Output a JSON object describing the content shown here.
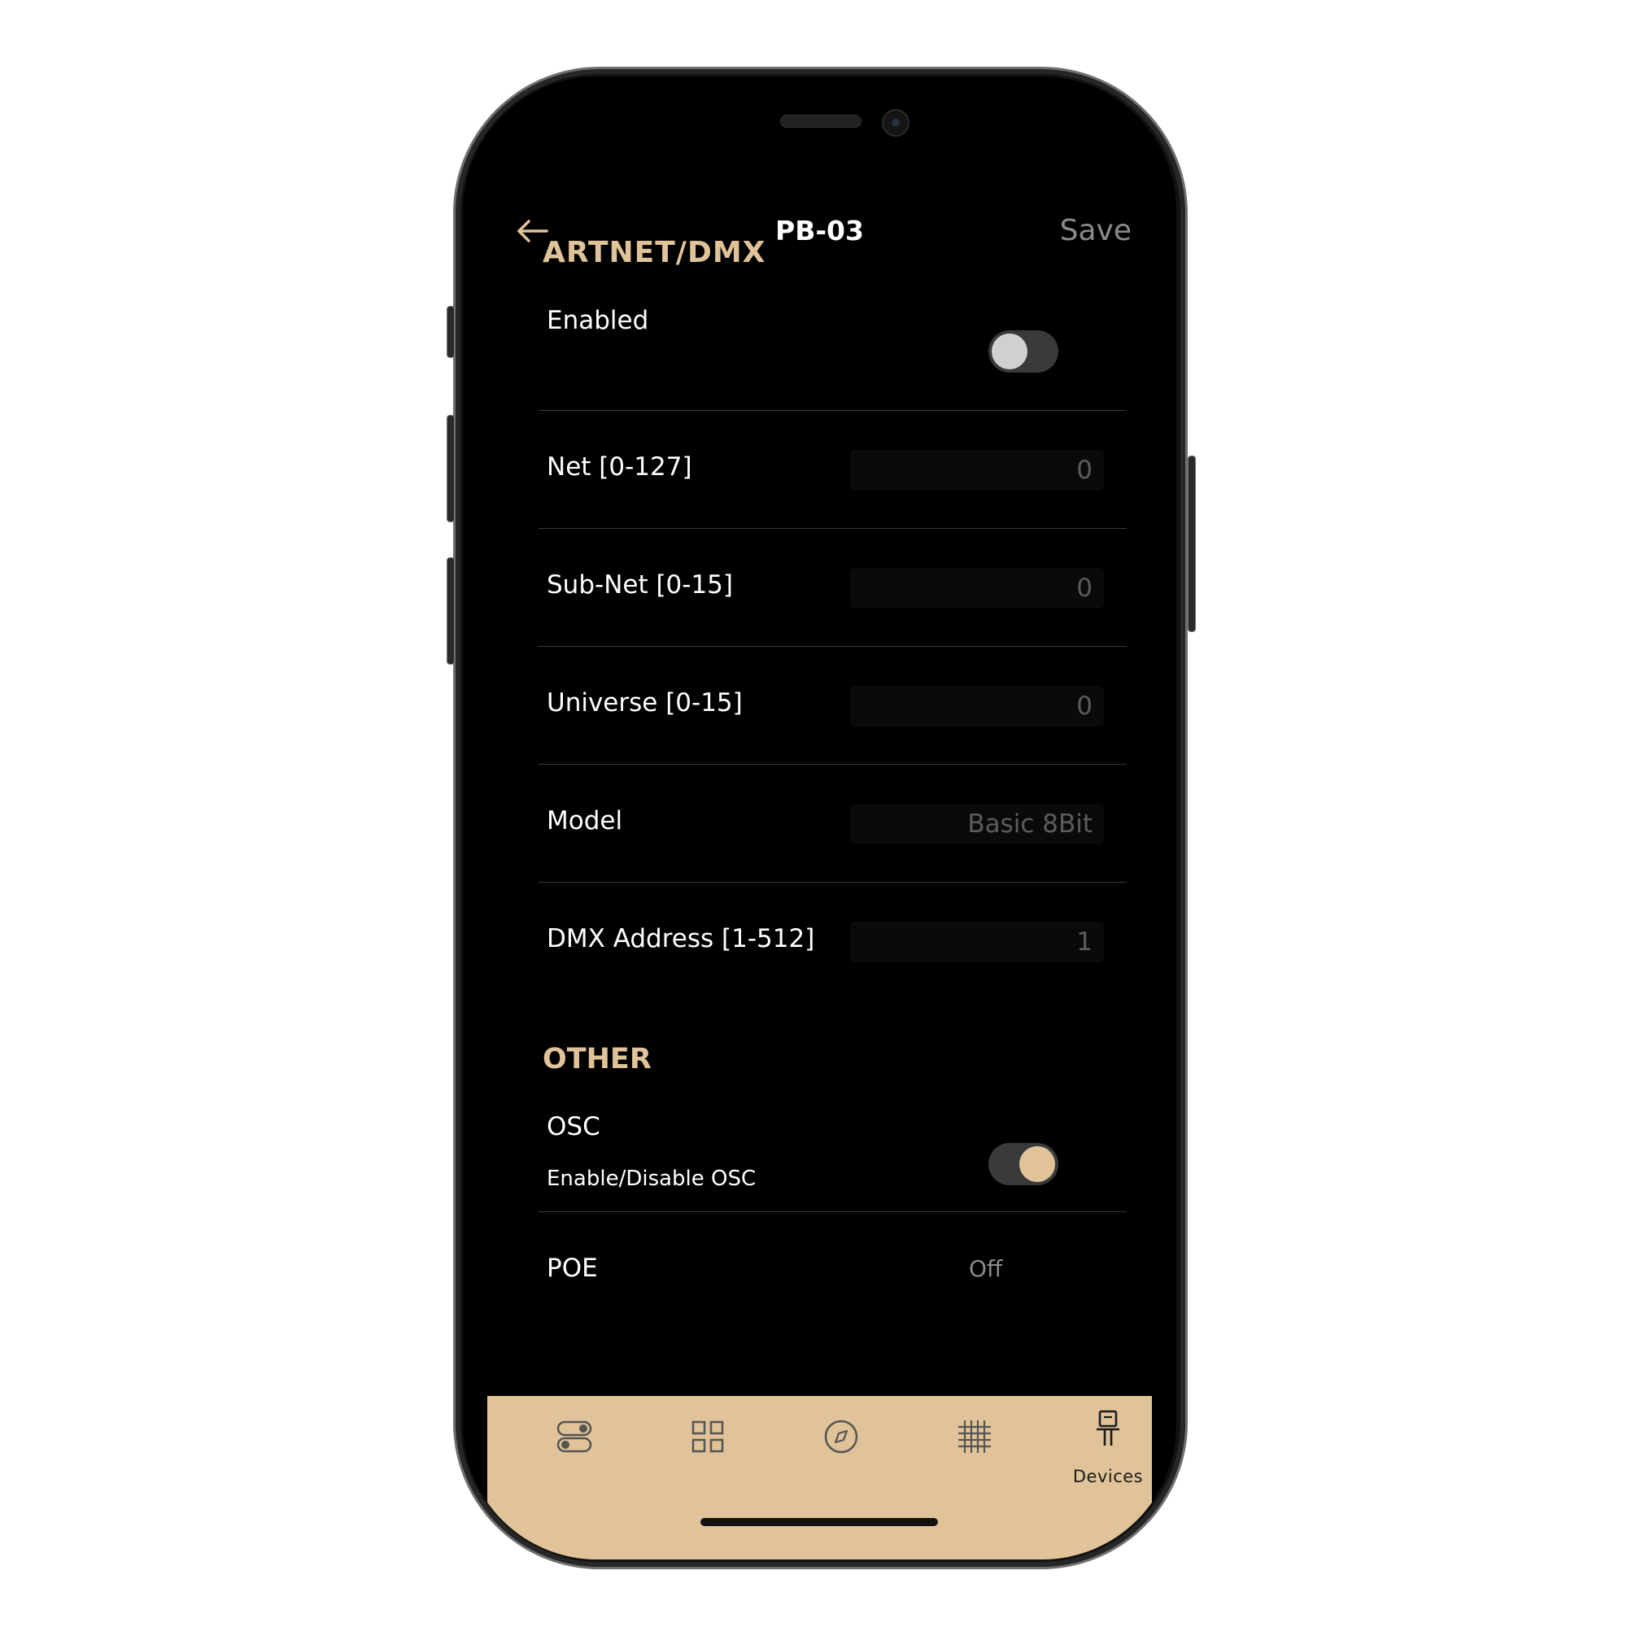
{
  "header": {
    "title": "PB-03",
    "save_label": "Save",
    "back_icon": "arrow-left-icon"
  },
  "sections": {
    "artnet_heading": "ARTNET/DMX",
    "other_heading": "OTHER"
  },
  "artnet": {
    "enabled_label": "Enabled",
    "enabled_state": false,
    "net_label": "Net [0-127]",
    "net_value": "0",
    "subnet_label": "Sub-Net [0-15]",
    "subnet_value": "0",
    "universe_label": "Universe [0-15]",
    "universe_value": "0",
    "model_label": "Model",
    "model_value": "Basic 8Bit",
    "dmx_label": "DMX Address [1-512]",
    "dmx_value": "1"
  },
  "other": {
    "osc_label": "OSC",
    "osc_sub": "Enable/Disable OSC",
    "osc_state": true,
    "poe_label": "POE",
    "poe_value": "Off"
  },
  "tabbar": {
    "active_label": "Devices",
    "icons": [
      "toggles-icon",
      "grid-icon",
      "compass-icon",
      "hash-grid-icon",
      "device-icon"
    ]
  },
  "colors": {
    "accent": "#e0c398",
    "background": "#000000",
    "muted_text": "#8a8a8a"
  }
}
